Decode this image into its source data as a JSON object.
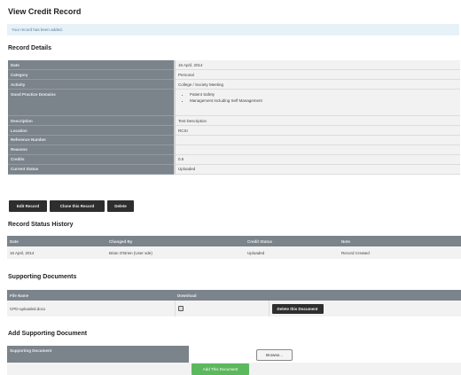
{
  "page": {
    "title": "View Credit Record",
    "notice": "Your record has been added."
  },
  "details": {
    "heading": "Record Details",
    "rows": [
      {
        "label": "Date",
        "value": "16 April, 2014"
      },
      {
        "label": "Category",
        "value": "Personal"
      },
      {
        "label": "Activity",
        "value": "College / Society Meeting"
      },
      {
        "label": "Good Practice Domains",
        "items": [
          "Patient Safety",
          "Management including Self Management"
        ]
      },
      {
        "label": "Description",
        "value": "Test Description"
      },
      {
        "label": "Location",
        "value": "RCSI"
      },
      {
        "label": "Reference Number",
        "value": ""
      },
      {
        "label": "Reasons",
        "value": ""
      },
      {
        "label": "Credits",
        "value": "0.5"
      },
      {
        "label": "Current Status",
        "value": "Uploaded"
      }
    ]
  },
  "actions": {
    "edit": "Edit Record",
    "clone": "Clone this Record",
    "delete": "Delete"
  },
  "history": {
    "heading": "Record Status History",
    "columns": [
      "Date",
      "Changed By",
      "Credit Status",
      "Note"
    ],
    "rows": [
      [
        "16 April, 2014",
        "Brian O'Brien (User sde)",
        "Uploaded",
        "Record Created"
      ]
    ]
  },
  "documents": {
    "heading": "Supporting Documents",
    "columns": [
      "File Name",
      "Download",
      ""
    ],
    "rows": [
      {
        "file": "CPD-uploaded.docx",
        "action": "Delete this Document"
      }
    ]
  },
  "add_document": {
    "heading": "Add Supporting Document",
    "label": "Supporting Document",
    "browse": "Browse...",
    "submit": "Add This Document"
  }
}
